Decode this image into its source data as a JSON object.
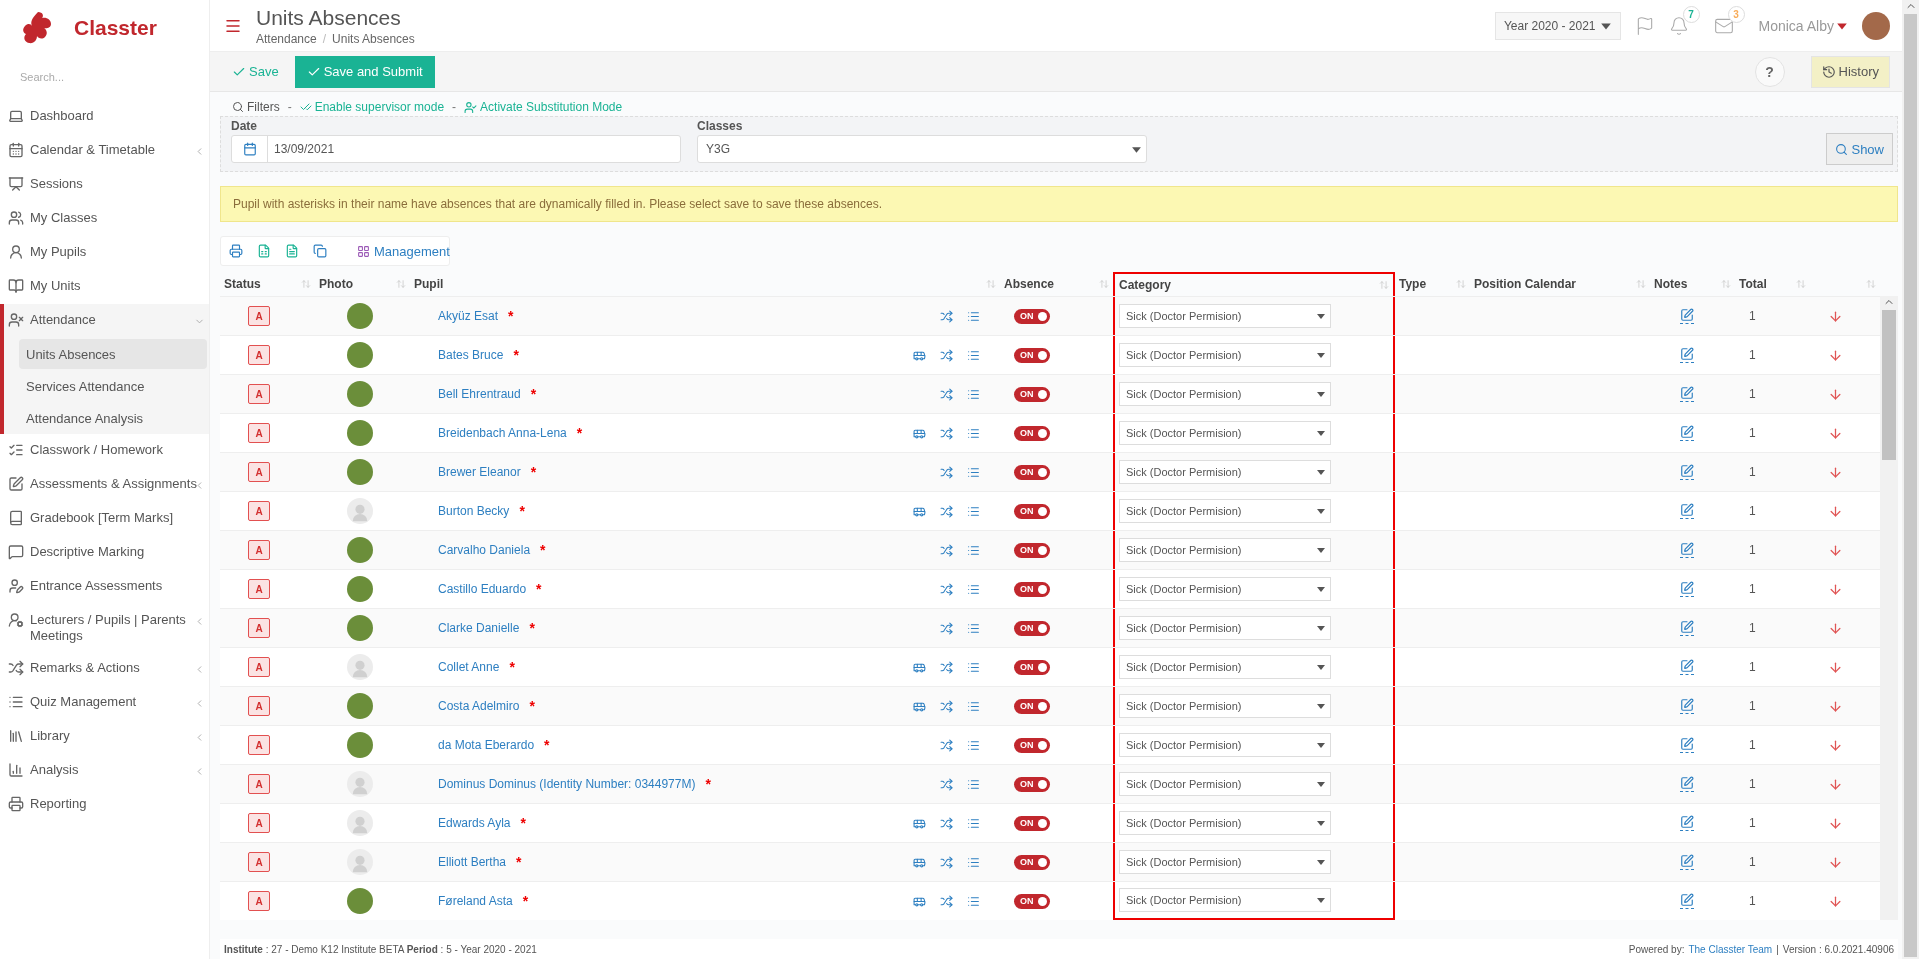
{
  "brand": {
    "name": "Classter"
  },
  "sidebar": {
    "search_placeholder": "Search...",
    "items": [
      {
        "label": "Dashboard",
        "expandable": false,
        "expanded": false,
        "selected": false
      },
      {
        "label": "Calendar & Timetable",
        "expandable": true,
        "expanded": false,
        "selected": false
      },
      {
        "label": "Sessions",
        "expandable": false,
        "expanded": false,
        "selected": false
      },
      {
        "label": "My Classes",
        "expandable": false,
        "expanded": false,
        "selected": false
      },
      {
        "label": "My Pupils",
        "expandable": false,
        "expanded": false,
        "selected": false
      },
      {
        "label": "My Units",
        "expandable": false,
        "expanded": false,
        "selected": false
      },
      {
        "label": "Attendance",
        "expandable": true,
        "expanded": true,
        "selected": false,
        "children": [
          {
            "label": "Units Absences",
            "selected": true
          },
          {
            "label": "Services Attendance",
            "selected": false
          },
          {
            "label": "Attendance Analysis",
            "selected": false
          }
        ]
      },
      {
        "label": "Classwork / Homework",
        "expandable": false,
        "expanded": false,
        "selected": false
      },
      {
        "label": "Assessments & Assignments",
        "expandable": true,
        "expanded": false,
        "selected": false
      },
      {
        "label": "Gradebook [Term Marks]",
        "expandable": false,
        "expanded": false,
        "selected": false
      },
      {
        "label": "Descriptive Marking",
        "expandable": false,
        "expanded": false,
        "selected": false
      },
      {
        "label": "Entrance Assessments",
        "expandable": false,
        "expanded": false,
        "selected": false
      },
      {
        "label": "Lecturers / Pupils | Parents Meetings",
        "expandable": true,
        "expanded": false,
        "selected": false
      },
      {
        "label": "Remarks & Actions",
        "expandable": true,
        "expanded": false,
        "selected": false
      },
      {
        "label": "Quiz Management",
        "expandable": true,
        "expanded": false,
        "selected": false
      },
      {
        "label": "Library",
        "expandable": true,
        "expanded": false,
        "selected": false
      },
      {
        "label": "Analysis",
        "expandable": true,
        "expanded": false,
        "selected": false
      },
      {
        "label": "Reporting",
        "expandable": false,
        "expanded": false,
        "selected": false
      }
    ]
  },
  "header": {
    "title": "Units Absences",
    "breadcrumb": [
      "Attendance",
      "Units Absences"
    ],
    "breadcrumb_separator": "/",
    "year": "Year 2020 - 2021",
    "badges": [
      {
        "count": "7",
        "color": "#1ab394"
      },
      {
        "count": "3",
        "color": "#f8ac59"
      }
    ],
    "user": "Monica Alby"
  },
  "toolbar": {
    "save": "Save",
    "save_submit": "Save and Submit",
    "help": "?",
    "history": "History"
  },
  "filters": {
    "label": "Filters",
    "separator": "-",
    "supervisor": "Enable supervisor mode",
    "substitution": "Activate Substitution Mode",
    "date_label": "Date",
    "date_value": "13/09/2021",
    "classes_label": "Classes",
    "classes_value": "Y3G",
    "show": "Show"
  },
  "notice": "Pupil with asterisks in their name have absences that are dynamically filled in. Please select save to save these absences.",
  "table_tools": {
    "management": "Management"
  },
  "table": {
    "columns": [
      {
        "label": "Status",
        "highlighted": false
      },
      {
        "label": "Photo",
        "highlighted": false
      },
      {
        "label": "Pupil",
        "highlighted": false
      },
      {
        "label": "Absence",
        "highlighted": false
      },
      {
        "label": "Category",
        "highlighted": true
      },
      {
        "label": "Type",
        "highlighted": false
      },
      {
        "label": "Position Calendar",
        "highlighted": false
      },
      {
        "label": "Notes",
        "highlighted": false
      },
      {
        "label": "Total",
        "highlighted": false
      },
      {
        "highlighted": false
      }
    ],
    "rows": [
      {
        "status": "A",
        "photo": true,
        "pupil": "Akyüz Esat",
        "asterisk": "*",
        "bus": false,
        "absence_label": "ON",
        "absence_on": true,
        "category": "Sick (Doctor Permision)",
        "total": "1"
      },
      {
        "status": "A",
        "photo": true,
        "pupil": "Bates Bruce",
        "asterisk": "*",
        "bus": true,
        "absence_label": "ON",
        "absence_on": true,
        "category": "Sick (Doctor Permision)",
        "total": "1"
      },
      {
        "status": "A",
        "photo": true,
        "pupil": "Bell Ehrentraud",
        "asterisk": "*",
        "bus": false,
        "absence_label": "ON",
        "absence_on": true,
        "category": "Sick (Doctor Permision)",
        "total": "1"
      },
      {
        "status": "A",
        "photo": true,
        "pupil": "Breidenbach Anna-Lena",
        "asterisk": "*",
        "bus": true,
        "absence_label": "ON",
        "absence_on": true,
        "category": "Sick (Doctor Permision)",
        "total": "1"
      },
      {
        "status": "A",
        "photo": true,
        "pupil": "Brewer Eleanor",
        "asterisk": "*",
        "bus": false,
        "absence_label": "ON",
        "absence_on": true,
        "category": "Sick (Doctor Permision)",
        "total": "1"
      },
      {
        "status": "A",
        "photo": false,
        "pupil": "Burton Becky",
        "asterisk": "*",
        "bus": true,
        "absence_label": "ON",
        "absence_on": true,
        "category": "Sick (Doctor Permision)",
        "total": "1"
      },
      {
        "status": "A",
        "photo": true,
        "pupil": "Carvalho Daniela",
        "asterisk": "*",
        "bus": false,
        "absence_label": "ON",
        "absence_on": true,
        "category": "Sick (Doctor Permision)",
        "total": "1"
      },
      {
        "status": "A",
        "photo": true,
        "pupil": "Castillo Eduardo",
        "asterisk": "*",
        "bus": false,
        "absence_label": "ON",
        "absence_on": true,
        "category": "Sick (Doctor Permision)",
        "total": "1"
      },
      {
        "status": "A",
        "photo": true,
        "pupil": "Clarke Danielle",
        "asterisk": "*",
        "bus": false,
        "absence_label": "ON",
        "absence_on": true,
        "category": "Sick (Doctor Permision)",
        "total": "1"
      },
      {
        "status": "A",
        "photo": false,
        "pupil": "Collet Anne",
        "asterisk": "*",
        "bus": true,
        "absence_label": "ON",
        "absence_on": true,
        "category": "Sick (Doctor Permision)",
        "total": "1"
      },
      {
        "status": "A",
        "photo": true,
        "pupil": "Costa Adelmiro",
        "asterisk": "*",
        "bus": true,
        "absence_label": "ON",
        "absence_on": true,
        "category": "Sick (Doctor Permision)",
        "total": "1"
      },
      {
        "status": "A",
        "photo": true,
        "pupil": "da Mota Eberardo",
        "asterisk": "*",
        "bus": false,
        "absence_label": "ON",
        "absence_on": true,
        "category": "Sick (Doctor Permision)",
        "total": "1"
      },
      {
        "status": "A",
        "photo": false,
        "pupil": "Dominus Dominus (Identity Number: 0344977M)",
        "asterisk": "*",
        "bus": false,
        "absence_label": "ON",
        "absence_on": true,
        "category": "Sick (Doctor Permision)",
        "total": "1"
      },
      {
        "status": "A",
        "photo": false,
        "pupil": "Edwards Ayla",
        "asterisk": "*",
        "bus": true,
        "absence_label": "ON",
        "absence_on": true,
        "category": "Sick (Doctor Permision)",
        "total": "1"
      },
      {
        "status": "A",
        "photo": false,
        "pupil": "Elliott Bertha",
        "asterisk": "*",
        "bus": true,
        "absence_label": "ON",
        "absence_on": true,
        "category": "Sick (Doctor Permision)",
        "total": "1"
      },
      {
        "status": "A",
        "photo": true,
        "pupil": "Føreland Asta",
        "asterisk": "*",
        "bus": true,
        "absence_label": "ON",
        "absence_on": true,
        "category": "Sick (Doctor Permision)",
        "total": "1"
      }
    ]
  },
  "footer": {
    "info": "**Institute** : 27 - Demo K12 Institute BETA **Period** : 5 - Year 2020 - 2021",
    "powered": "Powered by:",
    "team": "The Classter Team",
    "divider": "|",
    "version": "Version : 6.0.2021.40906"
  }
}
